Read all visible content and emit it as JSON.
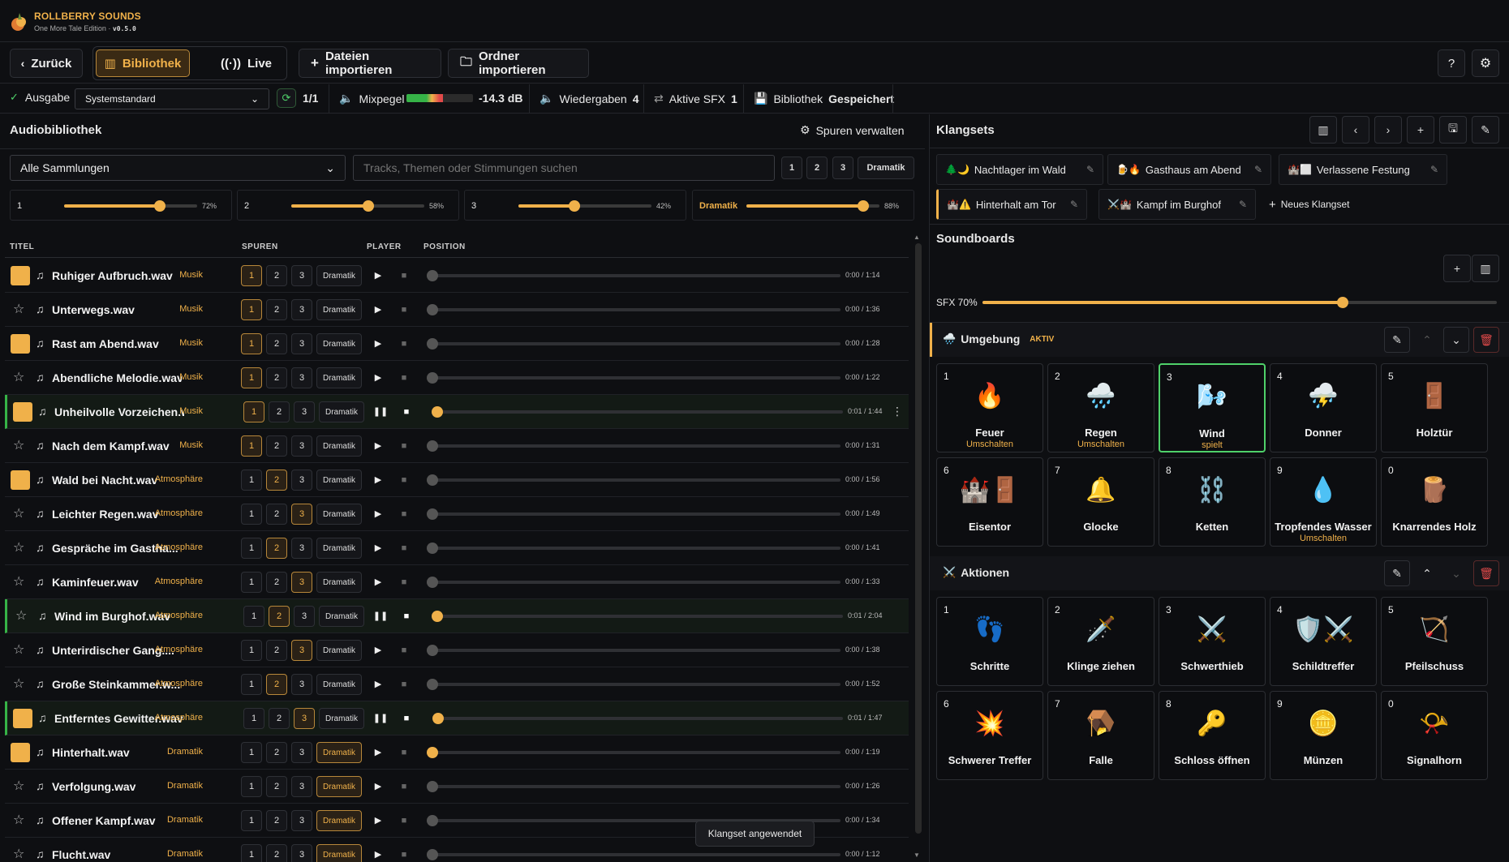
{
  "app": {
    "title": "ROLLBERRY SOUNDS",
    "edition": "One More Tale Edition",
    "version": "v0.5.0"
  },
  "nav": {
    "back": "Zurück",
    "library": "Bibliothek",
    "live": "Live",
    "import_files": "Dateien importieren",
    "import_folder": "Ordner importieren"
  },
  "status": {
    "output_label": "Ausgabe",
    "output_value": "Systemstandard",
    "output_count": "1/1",
    "mix_label": "Mixpegel",
    "mix_value": "-14.3 dB",
    "mix_level": 0.55,
    "plays_label": "Wiedergaben",
    "plays_value": "4",
    "sfx_label": "Aktive SFX",
    "sfx_value": "1",
    "lib_label": "Bibliothek",
    "lib_value": "Gespeichert"
  },
  "library": {
    "title": "Audiobibliothek",
    "manage": "Spuren verwalten",
    "collection": "Alle Sammlungen",
    "search_placeholder": "Tracks, Themen oder Stimmungen suchen",
    "filters": [
      "1",
      "2",
      "3",
      "Dramatik"
    ],
    "volumes": [
      {
        "label": "1",
        "value": 72,
        "text": "72%"
      },
      {
        "label": "2",
        "value": 58,
        "text": "58%"
      },
      {
        "label": "3",
        "value": 42,
        "text": "42%"
      },
      {
        "label": "Dramatik",
        "value": 88,
        "text": "88%"
      }
    ],
    "headers": {
      "title": "TITEL",
      "tracks": "SPUREN",
      "player": "PLAYER",
      "position": "POSITION"
    },
    "track_chips": [
      "1",
      "2",
      "3",
      "Dramatik"
    ],
    "rows": [
      {
        "name": "Ruhiger Aufbruch.wav",
        "cat": "Musik",
        "fav": true,
        "track": 1,
        "playing": false,
        "progress": 0,
        "time": "0:00 / 1:14"
      },
      {
        "name": "Unterwegs.wav",
        "cat": "Musik",
        "fav": false,
        "track": 1,
        "playing": false,
        "progress": 0,
        "time": "0:00 / 1:36"
      },
      {
        "name": "Rast am Abend.wav",
        "cat": "Musik",
        "fav": true,
        "track": 1,
        "playing": false,
        "progress": 0,
        "time": "0:00 / 1:28"
      },
      {
        "name": "Abendliche Melodie.wav",
        "cat": "Musik",
        "fav": false,
        "track": 1,
        "playing": false,
        "progress": 0,
        "time": "0:00 / 1:22"
      },
      {
        "name": "Unheilvolle Vorzeichen.wav",
        "cat": "Musik",
        "fav": true,
        "track": 1,
        "playing": true,
        "progress": 0.006,
        "time": "0:01 / 1:44"
      },
      {
        "name": "Nach dem Kampf.wav",
        "cat": "Musik",
        "fav": false,
        "track": 1,
        "playing": false,
        "progress": 0,
        "time": "0:00 / 1:31"
      },
      {
        "name": "Wald bei Nacht.wav",
        "cat": "Atmosphäre",
        "fav": true,
        "track": 2,
        "playing": false,
        "progress": 0,
        "time": "0:00 / 1:56"
      },
      {
        "name": "Leichter Regen.wav",
        "cat": "Atmosphäre",
        "fav": false,
        "track": 3,
        "playing": false,
        "progress": 0,
        "time": "0:00 / 1:49"
      },
      {
        "name": "Gespräche im Gastha...",
        "cat": "Atmosphäre",
        "fav": false,
        "track": 2,
        "playing": false,
        "progress": 0,
        "time": "0:00 / 1:41"
      },
      {
        "name": "Kaminfeuer.wav",
        "cat": "Atmosphäre",
        "fav": false,
        "track": 3,
        "playing": false,
        "progress": 0,
        "time": "0:00 / 1:33"
      },
      {
        "name": "Wind im Burghof.wav",
        "cat": "Atmosphäre",
        "fav": false,
        "track": 2,
        "playing": true,
        "progress": 0.005,
        "time": "0:01 / 2:04"
      },
      {
        "name": "Unterirdischer Gang....",
        "cat": "Atmosphäre",
        "fav": false,
        "track": 3,
        "playing": false,
        "progress": 0,
        "time": "0:00 / 1:38"
      },
      {
        "name": "Große Steinkammer.w...",
        "cat": "Atmosphäre",
        "fav": false,
        "track": 2,
        "playing": false,
        "progress": 0,
        "time": "0:00 / 1:52"
      },
      {
        "name": "Entferntes Gewitter.wav",
        "cat": "Atmosphäre",
        "fav": true,
        "track": 3,
        "playing": true,
        "progress": 0.007,
        "time": "0:01 / 1:47"
      },
      {
        "name": "Hinterhalt.wav",
        "cat": "Dramatik",
        "fav": true,
        "track": 4,
        "playing": false,
        "progress": 0,
        "time": "0:00 / 1:19",
        "knob_on": true
      },
      {
        "name": "Verfolgung.wav",
        "cat": "Dramatik",
        "fav": false,
        "track": 4,
        "playing": false,
        "progress": 0,
        "time": "0:00 / 1:26"
      },
      {
        "name": "Offener Kampf.wav",
        "cat": "Dramatik",
        "fav": false,
        "track": 4,
        "playing": false,
        "progress": 0,
        "time": "0:00 / 1:34"
      },
      {
        "name": "Flucht.wav",
        "cat": "Dramatik",
        "fav": false,
        "track": 4,
        "playing": false,
        "progress": 0,
        "time": "0:00 / 1:12"
      }
    ],
    "toast": "Klangset angewendet"
  },
  "klangsets": {
    "title": "Klangsets",
    "sets": [
      {
        "icons": "🌲🌙",
        "name": "Nachtlager im Wald"
      },
      {
        "icons": "🍺🔥",
        "name": "Gasthaus am Abend"
      },
      {
        "icons": "🏰⬜",
        "name": "Verlassene Festung"
      },
      {
        "icons": "🏰⚠️",
        "name": "Hinterhalt am Tor",
        "active": true
      },
      {
        "icons": "⚔️🏰",
        "name": "Kampf im Burghof"
      }
    ],
    "new_set": "Neues Klangset"
  },
  "soundboards": {
    "title": "Soundboards",
    "sfx_label": "SFX 70%",
    "sfx_value": 70,
    "groups": [
      {
        "icon": "🌧️",
        "name": "Umgebung",
        "badge": "AKTIV",
        "pads": [
          {
            "n": "1",
            "icon": "🔥",
            "label": "Feuer",
            "sub": "Umschalten"
          },
          {
            "n": "2",
            "icon": "🌧️",
            "label": "Regen",
            "sub": "Umschalten"
          },
          {
            "n": "3",
            "icon": "🌬️",
            "label": "Wind",
            "sub": "spielt",
            "playing": true
          },
          {
            "n": "4",
            "icon": "⛈️",
            "label": "Donner",
            "sub": ""
          },
          {
            "n": "5",
            "icon": "🚪",
            "label": "Holztür",
            "sub": ""
          },
          {
            "n": "6",
            "icon": "🏰🚪",
            "label": "Eisentor",
            "sub": ""
          },
          {
            "n": "7",
            "icon": "🔔",
            "label": "Glocke",
            "sub": ""
          },
          {
            "n": "8",
            "icon": "⛓️",
            "label": "Ketten",
            "sub": ""
          },
          {
            "n": "9",
            "icon": "💧",
            "label": "Tropfendes Wasser",
            "sub": "Umschalten"
          },
          {
            "n": "0",
            "icon": "🪵",
            "label": "Knarrendes Holz",
            "sub": ""
          }
        ]
      },
      {
        "icon": "⚔️",
        "name": "Aktionen",
        "badge": "",
        "pads": [
          {
            "n": "1",
            "icon": "👣",
            "label": "Schritte",
            "sub": ""
          },
          {
            "n": "2",
            "icon": "🗡️",
            "label": "Klinge ziehen",
            "sub": ""
          },
          {
            "n": "3",
            "icon": "⚔️",
            "label": "Schwerthieb",
            "sub": ""
          },
          {
            "n": "4",
            "icon": "🛡️⚔️",
            "label": "Schildtreffer",
            "sub": ""
          },
          {
            "n": "5",
            "icon": "🏹",
            "label": "Pfeilschuss",
            "sub": ""
          },
          {
            "n": "6",
            "icon": "💥",
            "label": "Schwerer Treffer",
            "sub": ""
          },
          {
            "n": "7",
            "icon": "🪤",
            "label": "Falle",
            "sub": ""
          },
          {
            "n": "8",
            "icon": "🔑",
            "label": "Schloss öffnen",
            "sub": ""
          },
          {
            "n": "9",
            "icon": "🪙",
            "label": "Münzen",
            "sub": ""
          },
          {
            "n": "0",
            "icon": "📯",
            "label": "Signalhorn",
            "sub": ""
          }
        ]
      }
    ]
  },
  "colors": {
    "accent": "#f0b14a",
    "playing": "#36b347",
    "danger": "#e14a4a"
  }
}
